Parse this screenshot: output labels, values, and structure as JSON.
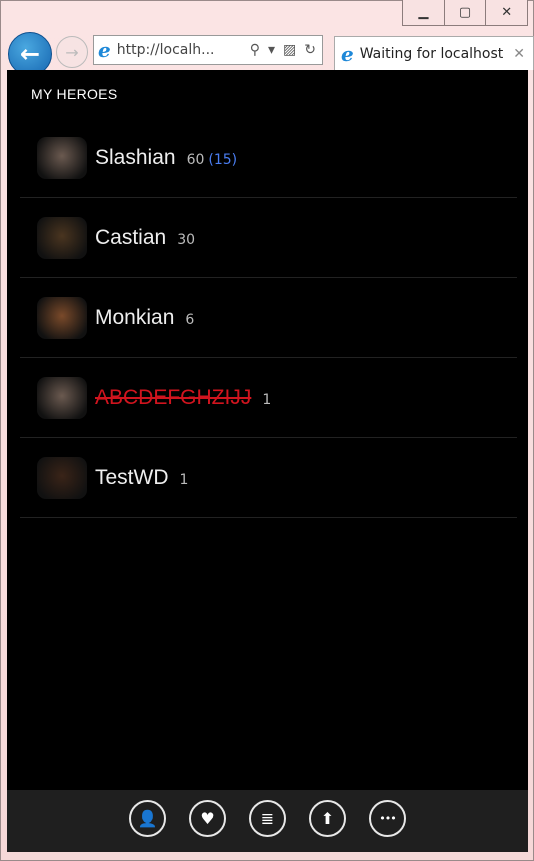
{
  "browser": {
    "window_controls": {
      "minimize": "▁",
      "restore": "▢",
      "close": "✕"
    },
    "address": "http://localh...",
    "tab_title": "Waiting for localhost"
  },
  "page": {
    "heading": "MY HEROES"
  },
  "heroes": [
    {
      "name": "Slashian",
      "level": "60",
      "paragon": "(15)",
      "deleted": false,
      "avatar_color": "#6b5a50"
    },
    {
      "name": "Castian",
      "level": "30",
      "paragon": "",
      "deleted": false,
      "avatar_color": "#4a3520"
    },
    {
      "name": "Monkian",
      "level": "6",
      "paragon": "",
      "deleted": false,
      "avatar_color": "#7a4a2a"
    },
    {
      "name": "ABCDEFGHZIJJ",
      "level": "1",
      "paragon": "",
      "deleted": true,
      "avatar_color": "#6b5a50"
    },
    {
      "name": "TestWD",
      "level": "1",
      "paragon": "",
      "deleted": false,
      "avatar_color": "#3a2418"
    }
  ],
  "appbar": [
    {
      "icon": "person-icon",
      "glyph": "👤"
    },
    {
      "icon": "heart-icon",
      "glyph": "♥"
    },
    {
      "icon": "list-icon",
      "glyph": "≣"
    },
    {
      "icon": "arrow-up-icon",
      "glyph": "⬆"
    },
    {
      "icon": "more-icon",
      "glyph": "•••"
    }
  ]
}
